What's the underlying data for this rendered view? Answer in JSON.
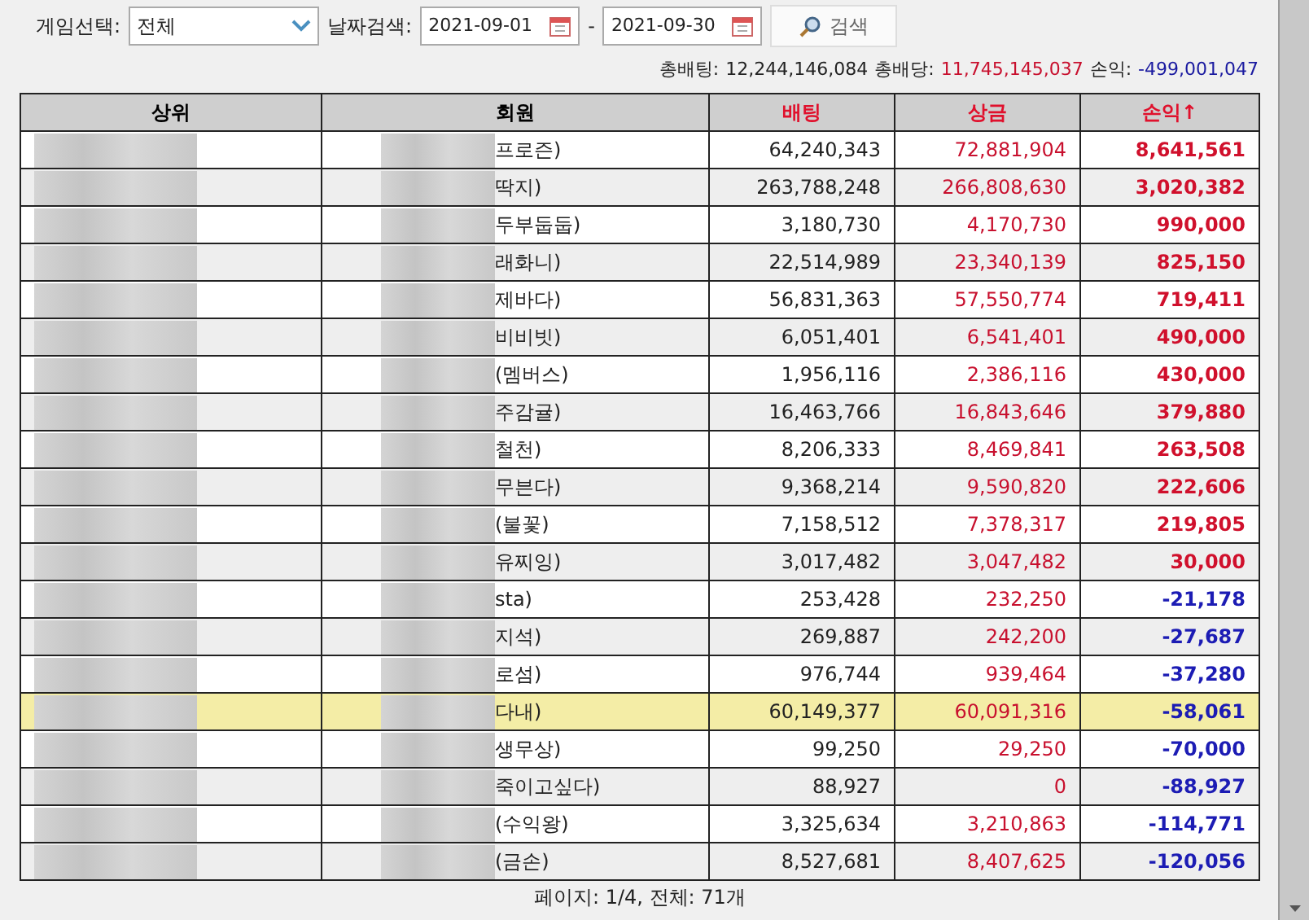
{
  "filters": {
    "game_label": "게임선택:",
    "game_value": "전체",
    "date_label": "날짜검색:",
    "date_from": "2021-09-01",
    "date_sep": "-",
    "date_to": "2021-09-30",
    "search_button": "검색"
  },
  "totals": [
    {
      "label": "총배팅:",
      "value": "12,244,146,084",
      "color": "#222222"
    },
    {
      "label": "총배당:",
      "value": "11,745,145,037",
      "color": "#c8102e"
    },
    {
      "label": "손익:",
      "value": "-499,001,047",
      "color": "#1a1aa0"
    }
  ],
  "table": {
    "columns": [
      {
        "label": "상위",
        "color": "#000000"
      },
      {
        "label": "회원",
        "color": "#000000"
      },
      {
        "label": "배팅",
        "color": "#e0102c"
      },
      {
        "label": "상금",
        "color": "#e0102c"
      },
      {
        "label": "손익↑",
        "color": "#e0102c"
      }
    ],
    "rows": [
      {
        "member": "프로즌)",
        "bet": "64,240,343",
        "prize": "72,881,904",
        "profit": "8,641,561",
        "color": "#d0102c",
        "selected": false
      },
      {
        "member": "딱지)",
        "bet": "263,788,248",
        "prize": "266,808,630",
        "profit": "3,020,382",
        "color": "#d0102c",
        "selected": false
      },
      {
        "member": "두부둡둡)",
        "bet": "3,180,730",
        "prize": "4,170,730",
        "profit": "990,000",
        "color": "#d0102c",
        "selected": false
      },
      {
        "member": "래화니)",
        "bet": "22,514,989",
        "prize": "23,340,139",
        "profit": "825,150",
        "color": "#d0102c",
        "selected": false
      },
      {
        "member": "제바다)",
        "bet": "56,831,363",
        "prize": "57,550,774",
        "profit": "719,411",
        "color": "#d0102c",
        "selected": false
      },
      {
        "member": "비비빗)",
        "bet": "6,051,401",
        "prize": "6,541,401",
        "profit": "490,000",
        "color": "#d0102c",
        "selected": false
      },
      {
        "member": "(멤버스)",
        "bet": "1,956,116",
        "prize": "2,386,116",
        "profit": "430,000",
        "color": "#d0102c",
        "selected": false
      },
      {
        "member": "주감귤)",
        "bet": "16,463,766",
        "prize": "16,843,646",
        "profit": "379,880",
        "color": "#d0102c",
        "selected": false
      },
      {
        "member": "철천)",
        "bet": "8,206,333",
        "prize": "8,469,841",
        "profit": "263,508",
        "color": "#d0102c",
        "selected": false
      },
      {
        "member": "무븐다)",
        "bet": "9,368,214",
        "prize": "9,590,820",
        "profit": "222,606",
        "color": "#d0102c",
        "selected": false
      },
      {
        "member": "(불꽃)",
        "bet": "7,158,512",
        "prize": "7,378,317",
        "profit": "219,805",
        "color": "#d0102c",
        "selected": false
      },
      {
        "member": "유찌잉)",
        "bet": "3,017,482",
        "prize": "3,047,482",
        "profit": "30,000",
        "color": "#d0102c",
        "selected": false
      },
      {
        "member": "sta)",
        "bet": "253,428",
        "prize": "232,250",
        "profit": "-21,178",
        "color": "#1c1cb4",
        "selected": false
      },
      {
        "member": "지석)",
        "bet": "269,887",
        "prize": "242,200",
        "profit": "-27,687",
        "color": "#1c1cb4",
        "selected": false
      },
      {
        "member": "로섬)",
        "bet": "976,744",
        "prize": "939,464",
        "profit": "-37,280",
        "color": "#1c1cb4",
        "selected": false
      },
      {
        "member": "다내)",
        "bet": "60,149,377",
        "prize": "60,091,316",
        "profit": "-58,061",
        "color": "#1c1cb4",
        "selected": true
      },
      {
        "member": "생무상)",
        "bet": "99,250",
        "prize": "29,250",
        "profit": "-70,000",
        "color": "#1c1cb4",
        "selected": false
      },
      {
        "member": "죽이고싶다)",
        "bet": "88,927",
        "prize": "0",
        "profit": "-88,927",
        "color": "#1c1cb4",
        "selected": false
      },
      {
        "member": "(수익왕)",
        "bet": "3,325,634",
        "prize": "3,210,863",
        "profit": "-114,771",
        "color": "#1c1cb4",
        "selected": false
      },
      {
        "member": "(금손)",
        "bet": "8,527,681",
        "prize": "8,407,625",
        "profit": "-120,056",
        "color": "#1c1cb4",
        "selected": false
      }
    ]
  },
  "pagination": "페이지: 1/4, 전체: 71개"
}
